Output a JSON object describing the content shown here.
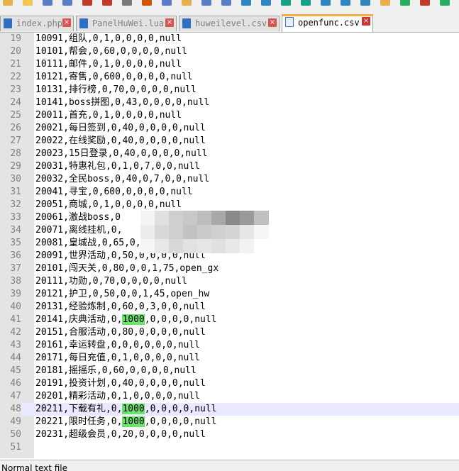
{
  "tabs": [
    {
      "label": "index.php"
    },
    {
      "label": "PanelHuWei.lua"
    },
    {
      "label": "huweilevel.csv"
    },
    {
      "label": "openfunc.csv"
    }
  ],
  "lines": [
    {
      "num": "19",
      "parts": [
        {
          "t": "10091,组队,0,1,0,0,0,0,null"
        }
      ]
    },
    {
      "num": "20",
      "parts": [
        {
          "t": "10101,帮会,0,60,0,0,0,0,null"
        }
      ]
    },
    {
      "num": "21",
      "parts": [
        {
          "t": "10111,邮件,0,1,0,0,0,0,null"
        }
      ]
    },
    {
      "num": "22",
      "parts": [
        {
          "t": "10121,寄售,0,600,0,0,0,0,null"
        }
      ]
    },
    {
      "num": "23",
      "parts": [
        {
          "t": "10131,排行榜,0,70,0,0,0,0,null"
        }
      ]
    },
    {
      "num": "24",
      "parts": [
        {
          "t": "10141,boss拼图,0,43,0,0,0,0,null"
        }
      ]
    },
    {
      "num": "25",
      "parts": [
        {
          "t": "20011,首充,0,1,0,0,0,0,null"
        }
      ]
    },
    {
      "num": "26",
      "parts": [
        {
          "t": "20021,每日签到,0,40,0,0,0,0,null"
        }
      ]
    },
    {
      "num": "27",
      "parts": [
        {
          "t": "20022,在线奖励,0,40,0,0,0,0,null"
        }
      ]
    },
    {
      "num": "28",
      "parts": [
        {
          "t": "20023,15日登录,0,40,0,0,0,0,null"
        }
      ]
    },
    {
      "num": "29",
      "parts": [
        {
          "t": "20031,特惠礼包,0,1,0,7,0,0,null"
        }
      ]
    },
    {
      "num": "30",
      "parts": [
        {
          "t": "20032,全民boss,0,40,0,7,0,0,null"
        }
      ]
    },
    {
      "num": "31",
      "parts": [
        {
          "t": "20041,寻宝,0,600,0,0,0,0,null"
        }
      ]
    },
    {
      "num": "32",
      "parts": [
        {
          "t": "20051,商城,0,1,0,0,0,0,null"
        }
      ]
    },
    {
      "num": "33",
      "parts": [
        {
          "t": "20061,激战boss,0              oss"
        }
      ]
    },
    {
      "num": "34",
      "parts": [
        {
          "t": "20071,离线挂机,0,"
        }
      ]
    },
    {
      "num": "35",
      "parts": [
        {
          "t": "20081,皇城战,0,65,0,"
        }
      ]
    },
    {
      "num": "36",
      "parts": [
        {
          "t": "20091,世界活动,0,50,0,0,0,0,null"
        }
      ]
    },
    {
      "num": "37",
      "parts": [
        {
          "t": "20101,闯天关,0,80,0,0,1,75,open_gx"
        }
      ]
    },
    {
      "num": "38",
      "parts": [
        {
          "t": "20111,功勋,0,70,0,0,0,0,null"
        }
      ]
    },
    {
      "num": "39",
      "parts": [
        {
          "t": "20121,护卫,0,50,0,0,1,45,open_hw"
        }
      ]
    },
    {
      "num": "40",
      "parts": [
        {
          "t": "20131,经验炼制,0,60,0,3,0,0,null"
        }
      ]
    },
    {
      "num": "41",
      "parts": [
        {
          "t": "20141,庆典活动,0,"
        },
        {
          "t": "1000",
          "hl": true
        },
        {
          "t": ",0,0,0,0,null"
        }
      ]
    },
    {
      "num": "42",
      "parts": [
        {
          "t": "20151,合服活动,0,80,0,0,0,0,null"
        }
      ]
    },
    {
      "num": "43",
      "parts": [
        {
          "t": "20161,幸运转盘,0,0,0,0,0,0,null"
        }
      ]
    },
    {
      "num": "44",
      "parts": [
        {
          "t": "20171,每日充值,0,1,0,0,0,0,null"
        }
      ]
    },
    {
      "num": "45",
      "parts": [
        {
          "t": "20181,摇摇乐,0,60,0,0,0,0,null"
        }
      ]
    },
    {
      "num": "46",
      "parts": [
        {
          "t": "20191,投资计划,0,40,0,0,0,0,null"
        }
      ]
    },
    {
      "num": "47",
      "parts": [
        {
          "t": "20201,精彩活动,0,1,0,0,0,0,null"
        }
      ]
    },
    {
      "num": "48",
      "current": true,
      "parts": [
        {
          "t": "20211,下载有礼,0,"
        },
        {
          "t": "1000",
          "hl": true
        },
        {
          "t": ",0,0,0,0,null"
        }
      ]
    },
    {
      "num": "49",
      "parts": [
        {
          "t": "20221,限时任务,0,"
        },
        {
          "t": "1000",
          "hl": true
        },
        {
          "t": ",0,0,0,0,null"
        }
      ]
    },
    {
      "num": "50",
      "parts": [
        {
          "t": "20231,超级会员,0,20,0,0,0,0,null"
        }
      ]
    },
    {
      "num": "51",
      "parts": [
        {
          "t": ""
        }
      ]
    }
  ],
  "status": {
    "text": "Normal text file"
  },
  "colors": {
    "tab_accent": "#f9ad41",
    "highlight": "#6ce26c",
    "current_line": "#e8e8ff"
  }
}
